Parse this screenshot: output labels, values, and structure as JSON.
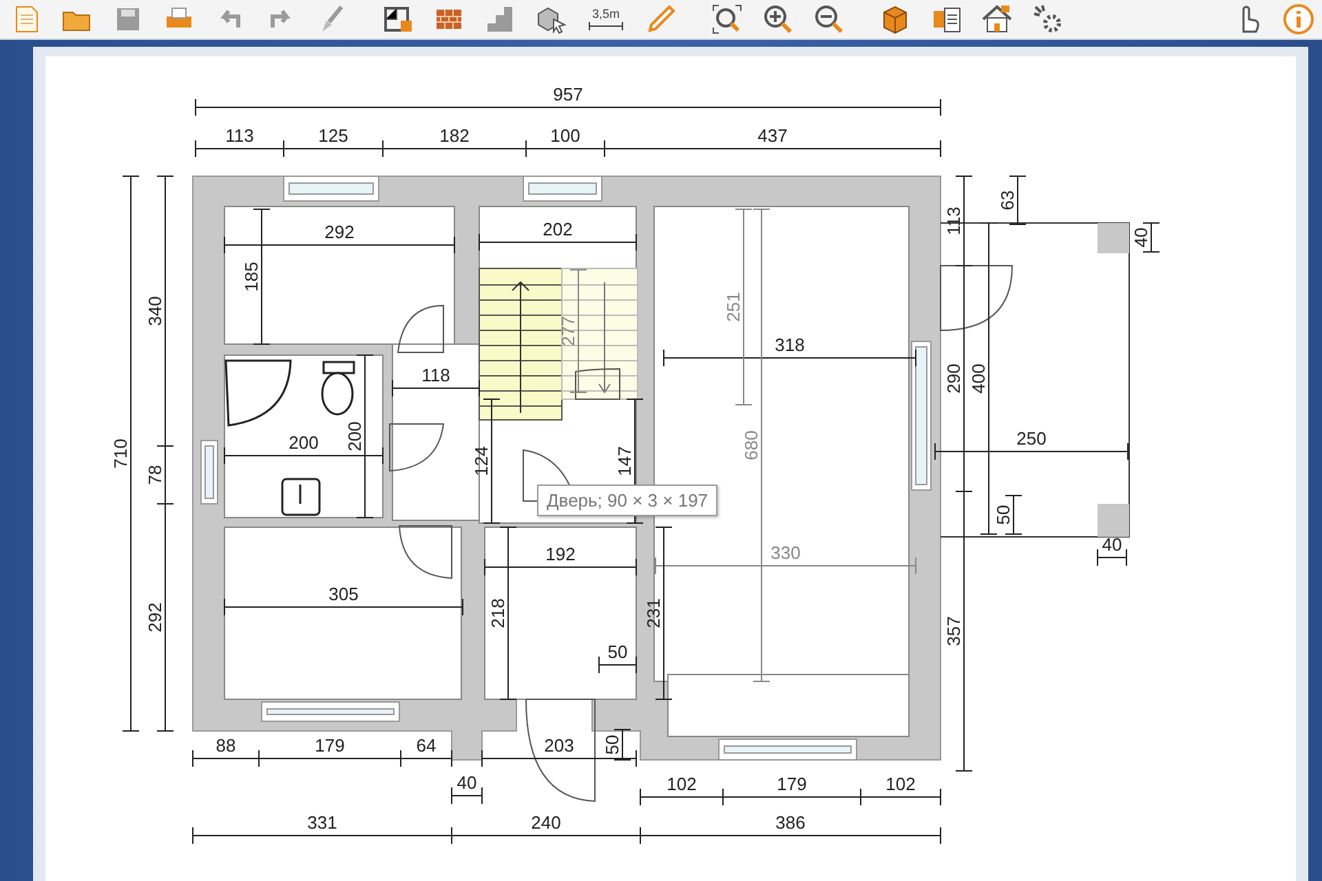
{
  "toolbar": {
    "tools": [
      {
        "kind": "new"
      },
      {
        "kind": "open"
      },
      {
        "kind": "save"
      },
      {
        "kind": "print"
      },
      {
        "kind": "undo"
      },
      {
        "kind": "redo"
      },
      {
        "kind": "brush"
      },
      {
        "kind": "plan"
      },
      {
        "kind": "wall"
      },
      {
        "kind": "steps"
      },
      {
        "kind": "select"
      },
      {
        "kind": "measure",
        "label": "3,5m"
      },
      {
        "kind": "pencil"
      },
      {
        "kind": "zoomfit"
      },
      {
        "kind": "zoomin"
      },
      {
        "kind": "zoomout"
      },
      {
        "kind": "box"
      },
      {
        "kind": "boxlist"
      },
      {
        "kind": "house"
      },
      {
        "kind": "gear"
      },
      {
        "kind": "hand"
      },
      {
        "kind": "info"
      }
    ]
  },
  "plan": {
    "horizontal_dimensions": [
      {
        "text": "957",
        "faded": false
      },
      {
        "text": "113",
        "faded": false
      },
      {
        "text": "125",
        "faded": false
      },
      {
        "text": "182",
        "faded": false
      },
      {
        "text": "100",
        "faded": false
      },
      {
        "text": "437",
        "faded": false
      },
      {
        "text": "292",
        "faded": false
      },
      {
        "text": "202",
        "faded": false
      },
      {
        "text": "118",
        "faded": false
      },
      {
        "text": "318",
        "faded": false
      },
      {
        "text": "200",
        "faded": false
      },
      {
        "text": "305",
        "faded": false
      },
      {
        "text": "192",
        "faded": false
      },
      {
        "text": "330",
        "faded": true
      },
      {
        "text": "50",
        "faded": false
      },
      {
        "text": "88",
        "faded": false
      },
      {
        "text": "179",
        "faded": false
      },
      {
        "text": "64",
        "faded": false
      },
      {
        "text": "203",
        "faded": false
      },
      {
        "text": "40",
        "faded": false
      },
      {
        "text": "102",
        "faded": false
      },
      {
        "text": "179",
        "faded": false
      },
      {
        "text": "102",
        "faded": false
      },
      {
        "text": "331",
        "faded": false
      },
      {
        "text": "240",
        "faded": false
      },
      {
        "text": "386",
        "faded": false
      },
      {
        "text": "250",
        "faded": false
      },
      {
        "text": "40",
        "faded": false
      }
    ],
    "vertical_dimensions": [
      {
        "text": "710",
        "faded": false
      },
      {
        "text": "340",
        "faded": false
      },
      {
        "text": "78",
        "faded": false
      },
      {
        "text": "292",
        "faded": false
      },
      {
        "text": "185",
        "faded": false
      },
      {
        "text": "200",
        "faded": false
      },
      {
        "text": "277",
        "faded": true
      },
      {
        "text": "251",
        "faded": true
      },
      {
        "text": "124",
        "faded": false
      },
      {
        "text": "147",
        "faded": false
      },
      {
        "text": "680",
        "faded": true
      },
      {
        "text": "218",
        "faded": false
      },
      {
        "text": "231",
        "faded": false
      },
      {
        "text": "50",
        "faded": false
      },
      {
        "text": "113",
        "faded": false
      },
      {
        "text": "63",
        "faded": false
      },
      {
        "text": "40",
        "faded": false
      },
      {
        "text": "290",
        "faded": false
      },
      {
        "text": "400",
        "faded": false
      },
      {
        "text": "357",
        "faded": false
      },
      {
        "text": "50",
        "faded": false
      }
    ],
    "tooltip": "Дверь; 90 × 3 × 197"
  }
}
